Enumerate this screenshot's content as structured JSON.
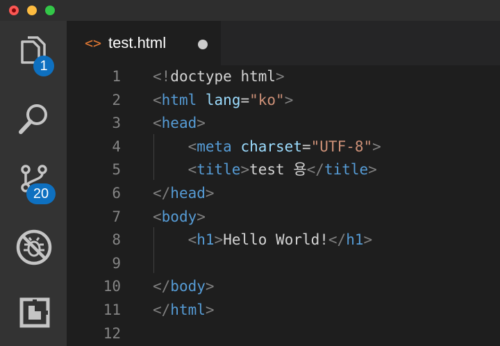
{
  "titlebar": {
    "buttons": [
      "close",
      "minimize",
      "maximize"
    ],
    "colors": {
      "close": "#fc5753",
      "minimize": "#fdbc40",
      "maximize": "#33c748"
    }
  },
  "activity_bar": {
    "items": [
      {
        "icon": "explorer-icon",
        "badge": "1"
      },
      {
        "icon": "search-icon",
        "badge": ""
      },
      {
        "icon": "source-control-icon",
        "badge": "20"
      },
      {
        "icon": "debug-icon",
        "badge": ""
      },
      {
        "icon": "extensions-icon",
        "badge": ""
      }
    ],
    "badge_color": "#0e70c0"
  },
  "tab": {
    "icon": "<>",
    "label": "test.html",
    "dirty": true,
    "icon_color": "#e37933"
  },
  "editor": {
    "lines": [
      {
        "number": "1",
        "tokens": [
          [
            "punct",
            "<!"
          ],
          [
            "text",
            "doctype html"
          ],
          [
            "punct",
            ">"
          ]
        ]
      },
      {
        "number": "2",
        "tokens": [
          [
            "punct",
            "<"
          ],
          [
            "tag",
            "html"
          ],
          [
            "text",
            " "
          ],
          [
            "attr",
            "lang"
          ],
          [
            "text",
            "="
          ],
          [
            "str",
            "\"ko\""
          ],
          [
            "punct",
            ">"
          ]
        ]
      },
      {
        "number": "3",
        "tokens": [
          [
            "punct",
            "<"
          ],
          [
            "tag",
            "head"
          ],
          [
            "punct",
            ">"
          ]
        ]
      },
      {
        "number": "4",
        "tokens": [
          [
            "text",
            "    "
          ],
          [
            "punct",
            "<"
          ],
          [
            "tag",
            "meta"
          ],
          [
            "text",
            " "
          ],
          [
            "attr",
            "charset"
          ],
          [
            "text",
            "="
          ],
          [
            "str",
            "\"UTF-8\""
          ],
          [
            "punct",
            ">"
          ]
        ]
      },
      {
        "number": "5",
        "tokens": [
          [
            "text",
            "    "
          ],
          [
            "punct",
            "<"
          ],
          [
            "tag",
            "title"
          ],
          [
            "punct",
            ">"
          ],
          [
            "text",
            "test 용"
          ],
          [
            "punct",
            "</"
          ],
          [
            "tag",
            "title"
          ],
          [
            "punct",
            ">"
          ]
        ]
      },
      {
        "number": "6",
        "tokens": [
          [
            "punct",
            "</"
          ],
          [
            "tag",
            "head"
          ],
          [
            "punct",
            ">"
          ]
        ]
      },
      {
        "number": "7",
        "tokens": [
          [
            "punct",
            "<"
          ],
          [
            "tag",
            "body"
          ],
          [
            "punct",
            ">"
          ]
        ]
      },
      {
        "number": "8",
        "tokens": [
          [
            "text",
            "    "
          ],
          [
            "punct",
            "<"
          ],
          [
            "tag",
            "h1"
          ],
          [
            "punct",
            ">"
          ],
          [
            "text",
            "Hello World!"
          ],
          [
            "punct",
            "</"
          ],
          [
            "tag",
            "h1"
          ],
          [
            "punct",
            ">"
          ]
        ]
      },
      {
        "number": "9",
        "tokens": []
      },
      {
        "number": "10",
        "tokens": [
          [
            "punct",
            "</"
          ],
          [
            "tag",
            "body"
          ],
          [
            "punct",
            ">"
          ]
        ]
      },
      {
        "number": "11",
        "tokens": [
          [
            "punct",
            "</"
          ],
          [
            "tag",
            "html"
          ],
          [
            "punct",
            ">"
          ]
        ]
      },
      {
        "number": "12",
        "tokens": []
      }
    ],
    "colors": {
      "tag": "#569cd6",
      "attr": "#9cdcfe",
      "string": "#ce9178",
      "punctuation": "#808080",
      "text": "#d4d4d4",
      "line_number": "#858585"
    }
  }
}
